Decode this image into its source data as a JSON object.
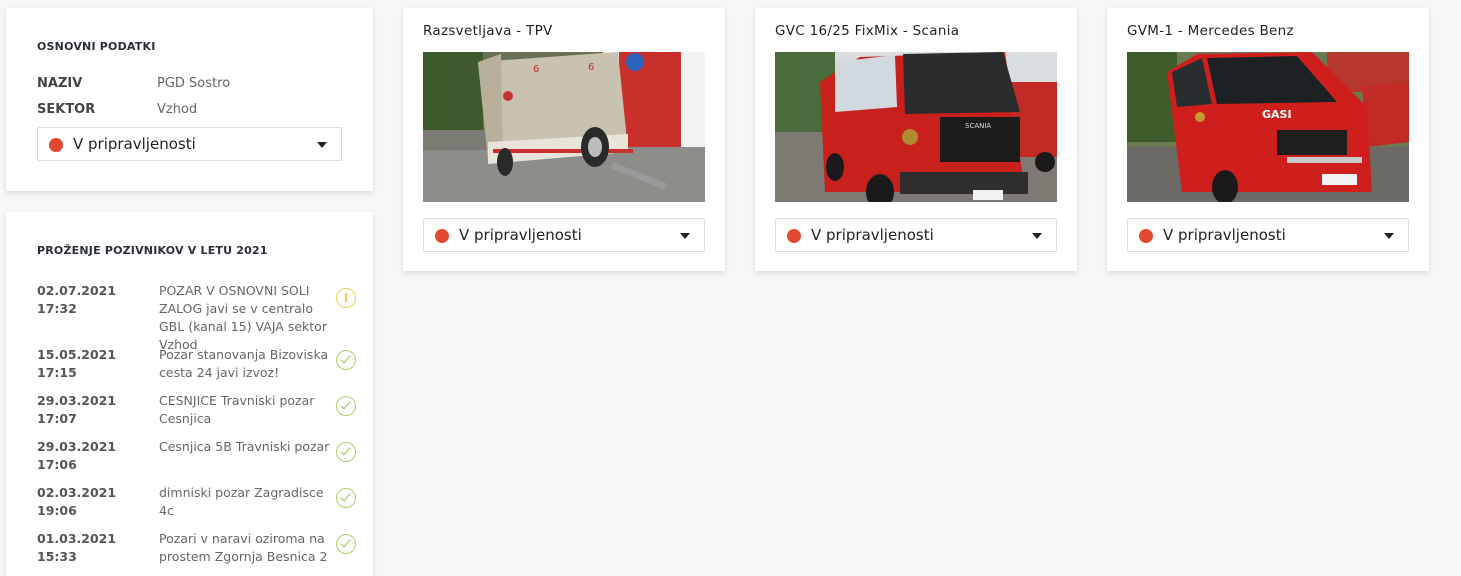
{
  "colors": {
    "status_red": "#e04a32",
    "check_green": "#8ecb4e",
    "warn_yellow": "#f2cf4a"
  },
  "basic_info": {
    "title": "OSNOVNI PODATKI",
    "naziv_label": "NAZIV",
    "naziv_value": "PGD Sostro",
    "sektor_label": "SEKTOR",
    "sektor_value": "Vzhod",
    "status": "V pripravljenosti"
  },
  "calls": {
    "title": "PROŽENJE POZIVNIKOV V LETU 2021",
    "items": [
      {
        "date": "02.07.2021",
        "time": "17:32",
        "text": "POZAR V OSNOVNI SOLI ZALOG javi se v centralo GBL (kanal 15) VAJA sektor Vzhod",
        "icon": "warning-icon"
      },
      {
        "date": "15.05.2021",
        "time": "17:15",
        "text": "Pozar stanovanja Bizoviska cesta 24 javi izvoz!",
        "icon": "check-icon"
      },
      {
        "date": "29.03.2021",
        "time": "17:07",
        "text": "CESNJICE Travniski pozar Cesnjica",
        "icon": "check-icon"
      },
      {
        "date": "29.03.2021",
        "time": "17:06",
        "text": "Cesnjica 5B Travniski pozar",
        "icon": "check-icon"
      },
      {
        "date": "02.03.2021",
        "time": "19:06",
        "text": "dimniski pozar Zagradisce 4c",
        "icon": "check-icon"
      },
      {
        "date": "01.03.2021",
        "time": "15:33",
        "text": "Pozari v naravi oziroma na prostem Zgornja Besnica 2",
        "icon": "check-icon"
      }
    ]
  },
  "vehicles": [
    {
      "name": "Razsvetljava - TPV",
      "status": "V pripravljenosti",
      "photo": "trailer-photo"
    },
    {
      "name": "GVC 16/25 FixMix - Scania",
      "status": "V pripravljenosti",
      "photo": "fire-truck-photo"
    },
    {
      "name": "GVM-1 - Mercedes Benz",
      "status": "V pripravljenosti",
      "photo": "fire-van-photo"
    }
  ]
}
